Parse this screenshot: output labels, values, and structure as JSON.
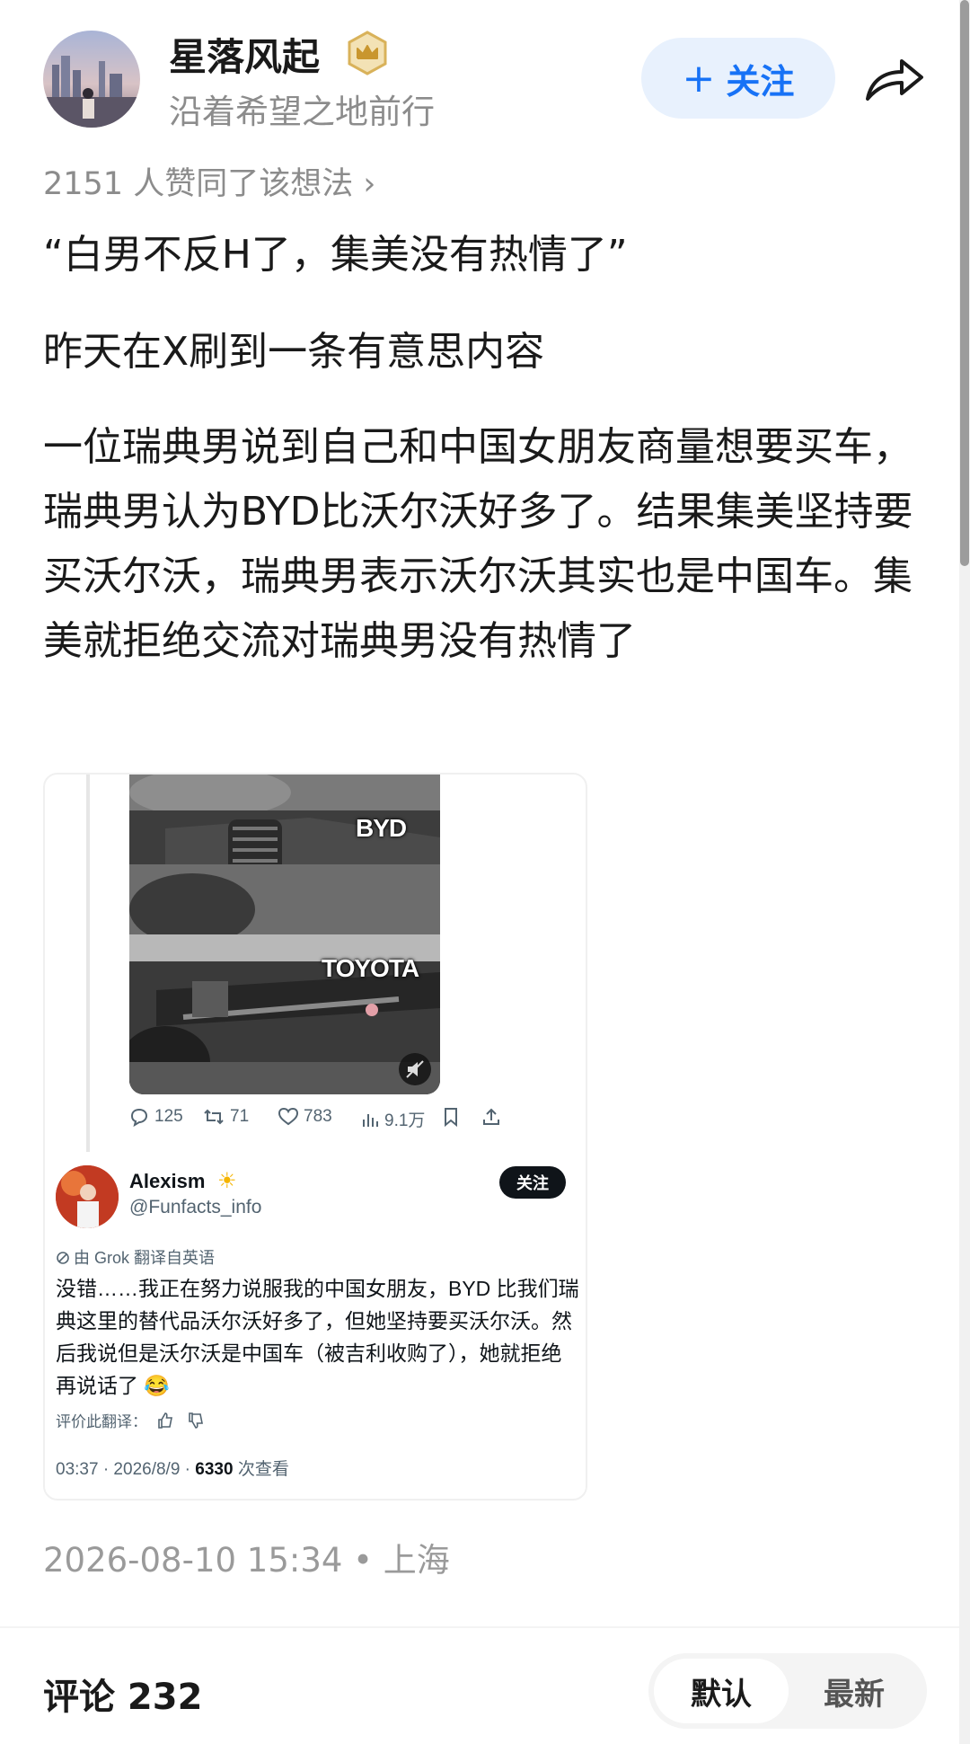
{
  "author": {
    "name": "星落风起",
    "signature": "沿着希望之地前行",
    "follow_label": "关注",
    "follow_plus": "+"
  },
  "likes_line": "2151 人赞同了该想法 ›",
  "paragraphs": [
    "“白男不反H了，集美没有热情了”",
    "昨天在X刷到一条有意思内容",
    "一位瑞典男说到自己和中国女朋友商量想要买车，瑞典男认为BYD比沃尔沃好多了。结果集美坚持要买沃尔沃，瑞典男表示沃尔沃其实也是中国车。集美就拒绝交流对瑞典男没有热情了"
  ],
  "tweet": {
    "video_labels": {
      "top": "BYD",
      "bottom": "TOYOTA"
    },
    "actions": {
      "replies": "125",
      "retweets": "71",
      "likes": "783",
      "views": "9.1万"
    },
    "name": "Alexism",
    "name_emoji": "☀",
    "handle": "@Funfacts_info",
    "follow_label": "关注",
    "translated_note": "由 Grok 翻译自英语",
    "body": "没错……我正在努力说服我的中国女朋友，BYD 比我们瑞典这里的替代品沃尔沃好多了，但她坚持要买沃尔沃。然后我说但是沃尔沃是中国车（被吉利收购了），她就拒绝再说话了 😂",
    "rate_label": "评价此翻译：",
    "meta_time": "03:37 · 2026/8/9 · ",
    "meta_views": "6330",
    "meta_views_suffix": " 次查看"
  },
  "post_time": "2026-08-10 15:34 • 上海",
  "comments": {
    "title": "评论 232",
    "sort_default": "默认",
    "sort_latest": "最新"
  },
  "colors": {
    "accent": "#1772f6",
    "follow_bg": "#e8f1fd",
    "muted": "#8c8c8c"
  },
  "icons": [
    "badge-icon",
    "share-icon",
    "reply-icon",
    "retweet-icon",
    "like-icon",
    "views-icon",
    "bookmark-icon",
    "upload-icon",
    "mute-icon",
    "thumb-up-icon",
    "thumb-down-icon",
    "translate-icon"
  ]
}
